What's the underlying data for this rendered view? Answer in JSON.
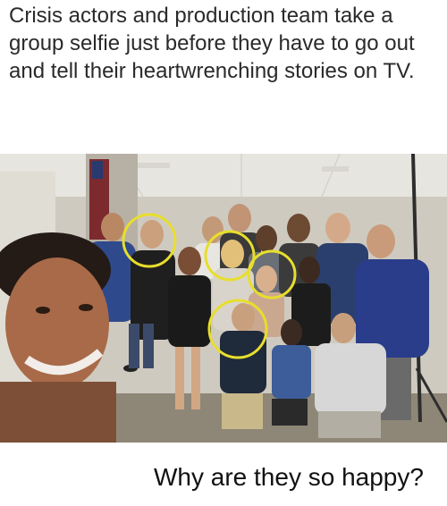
{
  "meme": {
    "caption": "Crisis actors and production team take a group selfie just before they have to go out and tell their heartwrenching stories on TV.",
    "footer": "Why are they so happy?"
  },
  "colors": {
    "wall": "#cfcac0",
    "ceiling": "#e7e5df",
    "floor": "#8e8777",
    "circle_highlight": "#e8de2c",
    "caption_text": "#2a2a2a"
  },
  "photo": {
    "highlight_circles": 4
  }
}
